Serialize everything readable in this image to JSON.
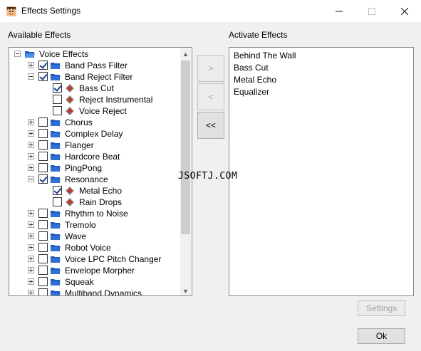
{
  "window": {
    "title": "Effects Settings",
    "minimize_icon": "minimize-icon",
    "maximize_icon": "maximize-icon",
    "close_icon": "close-icon"
  },
  "available": {
    "label": "Available Effects",
    "root": "Voice Effects",
    "rows": [
      {
        "text": "Band Pass Filter",
        "checked": true
      },
      {
        "text": "Band Reject Filter",
        "checked": true
      },
      {
        "text": "Bass Cut",
        "checked": true
      },
      {
        "text": "Reject Instrumental",
        "checked": false
      },
      {
        "text": "Voice Reject",
        "checked": false
      },
      {
        "text": "Chorus",
        "checked": false
      },
      {
        "text": "Complex Delay",
        "checked": false
      },
      {
        "text": "Flanger",
        "checked": false
      },
      {
        "text": "Hardcore Beat",
        "checked": false
      },
      {
        "text": "PingPong",
        "checked": false
      },
      {
        "text": "Resonance",
        "checked": true
      },
      {
        "text": "Metal Echo",
        "checked": true
      },
      {
        "text": "Rain Drops",
        "checked": false
      },
      {
        "text": "Rhythm to Noise",
        "checked": false
      },
      {
        "text": "Tremolo",
        "checked": false
      },
      {
        "text": "Wave",
        "checked": false
      },
      {
        "text": "Robot Voice",
        "checked": false
      },
      {
        "text": "Voice LPC Pitch Changer",
        "checked": false
      },
      {
        "text": "Envelope Morpher",
        "checked": false
      },
      {
        "text": "Squeak",
        "checked": false
      },
      {
        "text": "Multiband Dynamics",
        "checked": false
      }
    ]
  },
  "buttons": {
    "add": ">",
    "remove": "<",
    "remove_all": "<<",
    "settings": "Settings",
    "ok": "Ok"
  },
  "active": {
    "label": "Activate Effects",
    "items": [
      "Behind The Wall",
      "Bass Cut",
      "Metal Echo",
      "Equalizer"
    ]
  },
  "watermark": "JSOFTJ.COM",
  "colors": {
    "folder": "#2f6fd6",
    "effect": "#c0392b",
    "check": "#1c3f9a"
  }
}
